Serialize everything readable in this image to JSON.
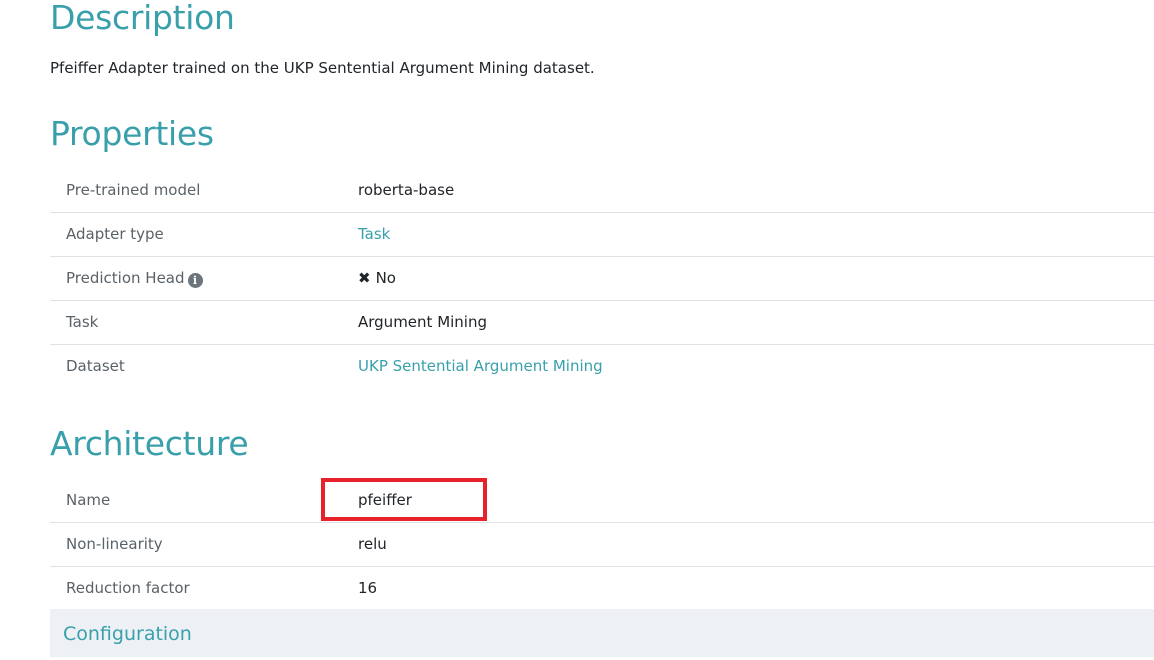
{
  "description": {
    "title": "Description",
    "text": "Pfeiffer Adapter trained on the UKP Sentential Argument Mining dataset."
  },
  "properties": {
    "title": "Properties",
    "rows": [
      {
        "key": "Pre-trained model",
        "value": "roberta-base"
      },
      {
        "key": "Adapter type",
        "value": "Task"
      },
      {
        "key": "Prediction Head",
        "value": "No"
      },
      {
        "key": "Task",
        "value": "Argument Mining"
      },
      {
        "key": "Dataset",
        "value": "UKP Sentential Argument Mining"
      }
    ]
  },
  "architecture": {
    "title": "Architecture",
    "rows": [
      {
        "key": "Name",
        "value": "pfeiffer"
      },
      {
        "key": "Non-linearity",
        "value": "relu"
      },
      {
        "key": "Reduction factor",
        "value": "16"
      }
    ]
  },
  "configuration": {
    "label": "Configuration"
  },
  "icons": {
    "info": "info-circle-icon",
    "no": "x-mark-icon"
  },
  "colors": {
    "accent": "#39a0ab",
    "highlight": "#e8222b",
    "config_bg": "#edf1f5"
  }
}
